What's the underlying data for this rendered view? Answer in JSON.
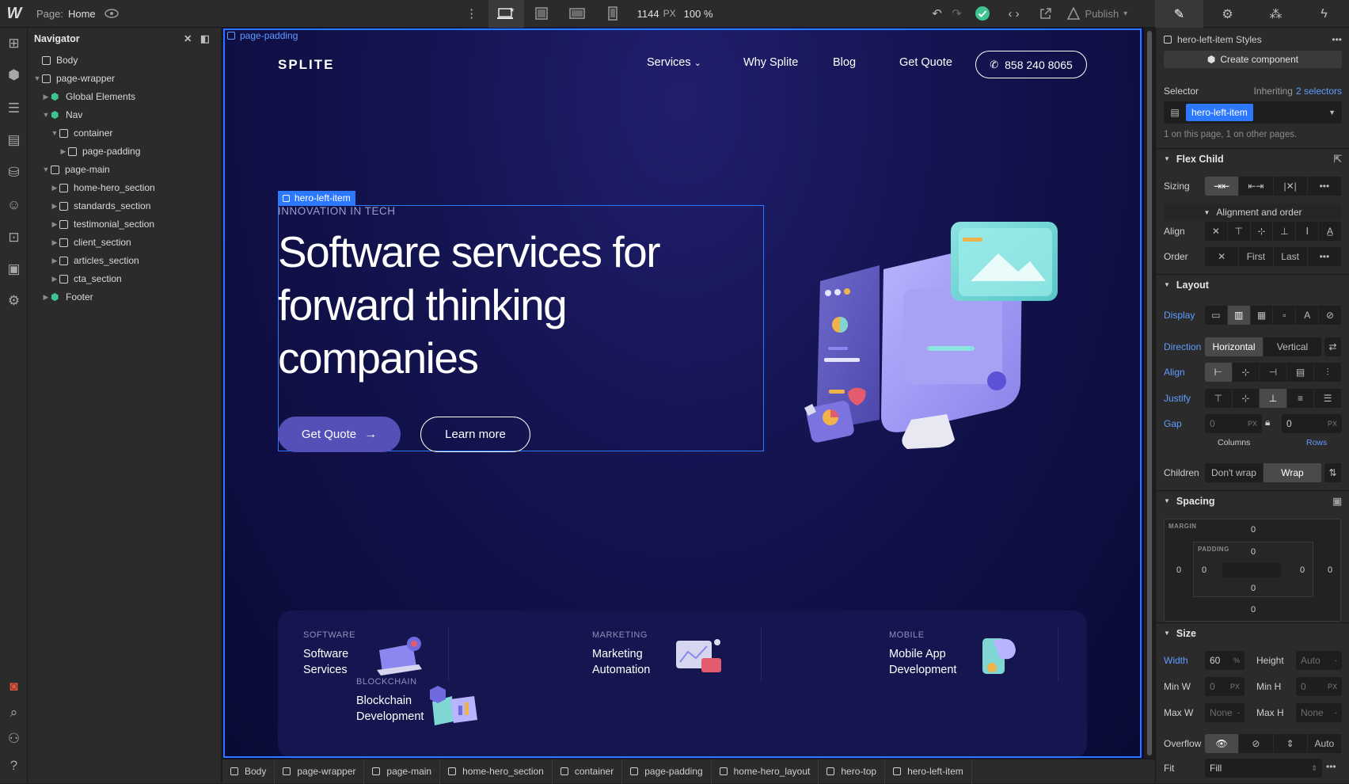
{
  "app": {
    "page_label": "Page:",
    "page_name": "Home",
    "canvas_width": "1144",
    "canvas_width_unit": "PX",
    "zoom": "100 %",
    "publish_label": "Publish",
    "accent_color": "#2c79ff",
    "status_color": "#3ec28f"
  },
  "navigator": {
    "title": "Navigator",
    "tree": [
      {
        "label": "Body",
        "type": "element",
        "caret": ""
      },
      {
        "label": "page-wrapper",
        "type": "element",
        "caret": "down"
      },
      {
        "label": "Global Elements",
        "type": "component",
        "caret": "right"
      },
      {
        "label": "Nav",
        "type": "component",
        "caret": "down"
      },
      {
        "label": "container",
        "type": "element",
        "caret": "down"
      },
      {
        "label": "page-padding",
        "type": "element",
        "caret": "right"
      },
      {
        "label": "page-main",
        "type": "element",
        "caret": "down"
      },
      {
        "label": "home-hero_section",
        "type": "element",
        "caret": "right"
      },
      {
        "label": "standards_section",
        "type": "element",
        "caret": "right"
      },
      {
        "label": "testimonial_section",
        "type": "element",
        "caret": "right"
      },
      {
        "label": "client_section",
        "type": "element",
        "caret": "right"
      },
      {
        "label": "articles_section",
        "type": "element",
        "caret": "right"
      },
      {
        "label": "cta_section",
        "type": "element",
        "caret": "right"
      },
      {
        "label": "Footer",
        "type": "component",
        "caret": "right"
      }
    ]
  },
  "canvas": {
    "selection_label": "page-padding",
    "hero_selection_label": "hero-left-item",
    "site": {
      "logo": "SPLITE",
      "nav": [
        "Services",
        "Why Splite",
        "Blog",
        "Get Quote"
      ],
      "phone": "858 240 8065",
      "eyebrow": "INNOVATION IN TECH",
      "headline_lines": [
        "Software services for",
        "forward thinking",
        "companies"
      ],
      "primary_cta": "Get Quote",
      "secondary_cta": "Learn more",
      "services": [
        {
          "category": "SOFTWARE",
          "title_lines": [
            "Software",
            "Services"
          ]
        },
        {
          "category": "BLOCKCHAIN",
          "title_lines": [
            "Blockchain",
            "Development"
          ]
        },
        {
          "category": "MARKETING",
          "title_lines": [
            "Marketing",
            "Automation"
          ]
        },
        {
          "category": "MOBILE",
          "title_lines": [
            "Mobile App",
            "Development"
          ]
        }
      ]
    }
  },
  "breadcrumbs": [
    "Body",
    "page-wrapper",
    "page-main",
    "home-hero_section",
    "container",
    "page-padding",
    "home-hero_layout",
    "hero-top",
    "hero-left-item"
  ],
  "style_panel": {
    "styles_title": "hero-left-item Styles",
    "create_component": "Create component",
    "selector_label": "Selector",
    "inheriting_label": "Inheriting",
    "inheriting_count": "2 selectors",
    "selector_chip": "hero-left-item",
    "usage_note": "1 on this page, 1 on other pages.",
    "flex_child": {
      "title": "Flex Child",
      "sizing_label": "Sizing",
      "alignment_toggle": "Alignment and order",
      "align_label": "Align",
      "order_label": "Order",
      "order_options": [
        "First",
        "Last"
      ]
    },
    "layout": {
      "title": "Layout",
      "display_label": "Display",
      "direction_label": "Direction",
      "direction_options": [
        "Horizontal",
        "Vertical"
      ],
      "align_label": "Align",
      "justify_label": "Justify",
      "gap_label": "Gap",
      "gap_columns": "0",
      "gap_rows": "0",
      "gap_unit": "PX",
      "columns_label": "Columns",
      "rows_label": "Rows",
      "children_label": "Children",
      "children_options": [
        "Don't wrap",
        "Wrap"
      ]
    },
    "spacing": {
      "title": "Spacing",
      "margin_label": "MARGIN",
      "padding_label": "PADDING",
      "margin": {
        "top": "0",
        "right": "0",
        "bottom": "0",
        "left": "0"
      },
      "padding": {
        "top": "0",
        "right": "0",
        "bottom": "0",
        "left": "0"
      }
    },
    "size": {
      "title": "Size",
      "width_label": "Width",
      "width_value": "60",
      "width_unit": "%",
      "height_label": "Height",
      "height_value": "Auto",
      "min_w_label": "Min W",
      "min_w_value": "0",
      "min_h_label": "Min H",
      "min_h_value": "0",
      "max_w_label": "Max W",
      "max_w_value": "None",
      "max_h_label": "Max H",
      "max_h_value": "None",
      "px_unit": "PX",
      "overflow_label": "Overflow",
      "overflow_auto": "Auto",
      "fit_label": "Fit",
      "fit_value": "Fill"
    }
  }
}
